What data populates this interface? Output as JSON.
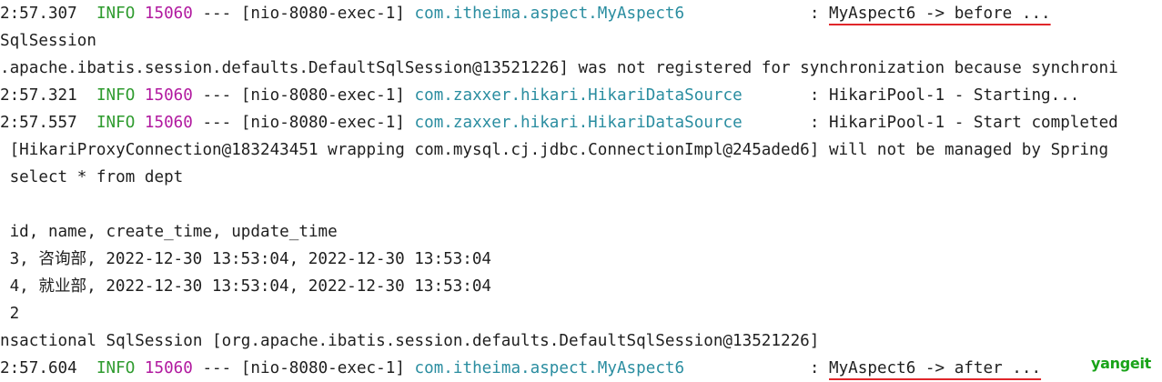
{
  "console": {
    "lines": [
      {
        "type": "log",
        "time": "2:57.307",
        "level": "INFO",
        "pid": "15060",
        "sep": "---",
        "thread": "[nio-8080-exec-1]",
        "logger": "com.itheima.aspect.MyAspect6",
        "colon": ":",
        "message": "MyAspect6 -> before ...",
        "underlined": true
      },
      {
        "type": "text",
        "text": "SqlSession"
      },
      {
        "type": "text",
        "text": ".apache.ibatis.session.defaults.DefaultSqlSession@13521226] was not registered for synchronization because synchroni"
      },
      {
        "type": "log",
        "time": "2:57.321",
        "level": "INFO",
        "pid": "15060",
        "sep": "---",
        "thread": "[nio-8080-exec-1]",
        "logger": "com.zaxxer.hikari.HikariDataSource",
        "colon": ":",
        "message": "HikariPool-1 - Starting...",
        "underlined": false
      },
      {
        "type": "log",
        "time": "2:57.557",
        "level": "INFO",
        "pid": "15060",
        "sep": "---",
        "thread": "[nio-8080-exec-1]",
        "logger": "com.zaxxer.hikari.HikariDataSource",
        "colon": ":",
        "message": "HikariPool-1 - Start completed",
        "underlined": false
      },
      {
        "type": "text",
        "text": " [HikariProxyConnection@183243451 wrapping com.mysql.cj.jdbc.ConnectionImpl@245aded6] will not be managed by Spring"
      },
      {
        "type": "text",
        "text": " select * from dept"
      },
      {
        "type": "text",
        "text": ""
      },
      {
        "type": "text",
        "text": " id, name, create_time, update_time"
      },
      {
        "type": "text",
        "text": " 3, 咨询部, 2022-12-30 13:53:04, 2022-12-30 13:53:04"
      },
      {
        "type": "text",
        "text": " 4, 就业部, 2022-12-30 13:53:04, 2022-12-30 13:53:04"
      },
      {
        "type": "text",
        "text": " 2"
      },
      {
        "type": "text",
        "text": "nsactional SqlSession [org.apache.ibatis.session.defaults.DefaultSqlSession@13521226]"
      },
      {
        "type": "log",
        "time": "2:57.604",
        "level": "INFO",
        "pid": "15060",
        "sep": "---",
        "thread": "[nio-8080-exec-1]",
        "logger": "com.itheima.aspect.MyAspect6",
        "colon": ":",
        "message": "MyAspect6 -> after ...",
        "underlined": true
      }
    ]
  },
  "watermark": "yangeit",
  "colors": {
    "info": "#2e9b2e",
    "pid": "#b1199f",
    "logger": "#2a8da0",
    "underline": "#e0262a",
    "watermark": "#19a319"
  }
}
